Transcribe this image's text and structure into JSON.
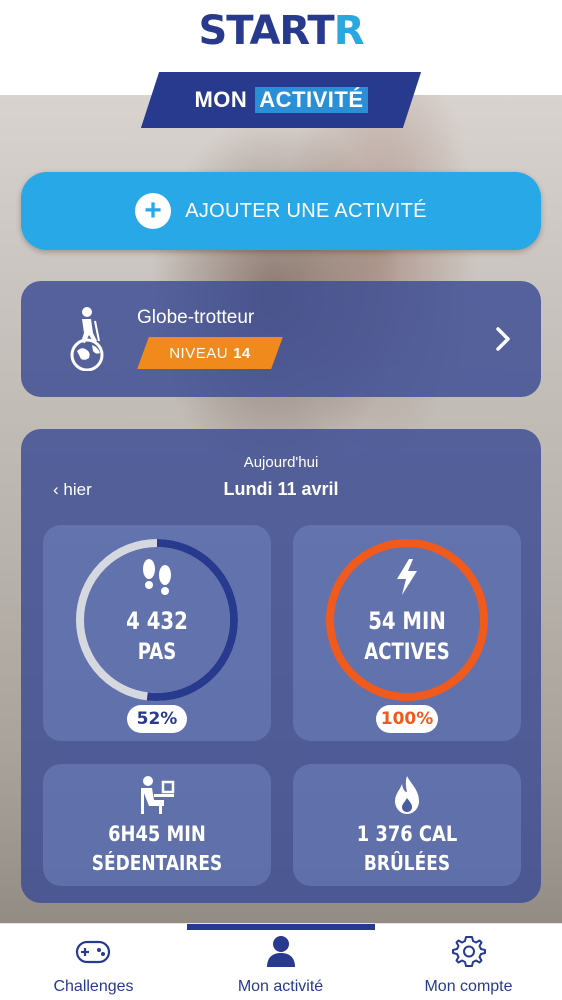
{
  "header": {
    "logo_main": "START",
    "logo_accent": "R",
    "title_part1": "MON",
    "title_part2": "ACTIVITÉ"
  },
  "add_activity": {
    "label": "AJOUTER UNE ACTIVITÉ",
    "icon": "plus-icon"
  },
  "level_card": {
    "title": "Globe-trotteur",
    "badge_prefix": "NIVEAU",
    "badge_level": "14",
    "icon": "globe-trotter-icon"
  },
  "day": {
    "today_label": "Aujourd'hui",
    "date": "Lundi 11 avril",
    "prev_label": "hier"
  },
  "stats": {
    "steps": {
      "value": "4 432",
      "unit": "PAS",
      "percent": "52%",
      "progress": 0.52,
      "icon": "footsteps-icon"
    },
    "active": {
      "value": "54 MIN",
      "unit": "ACTIVES",
      "percent": "100%",
      "progress": 1.0,
      "icon": "lightning-icon"
    },
    "sedentary": {
      "value": "6H45 MIN",
      "unit": "SÉDENTAIRES",
      "icon": "person-at-desk-icon"
    },
    "calories": {
      "value": "1 376 CAL",
      "unit": "BRÛLÉES",
      "icon": "flame-icon"
    }
  },
  "colors": {
    "brand_dark": "#283a8e",
    "brand_light": "#29a8e8",
    "orange": "#f08a1c",
    "active_ring": "#f05a1c",
    "steps_ring": "#283a8e"
  },
  "nav": {
    "items": [
      {
        "label": "Challenges",
        "icon": "gamepad-icon",
        "active": false
      },
      {
        "label": "Mon activité",
        "icon": "user-icon",
        "active": true
      },
      {
        "label": "Mon compte",
        "icon": "gear-icon",
        "active": false
      }
    ]
  }
}
